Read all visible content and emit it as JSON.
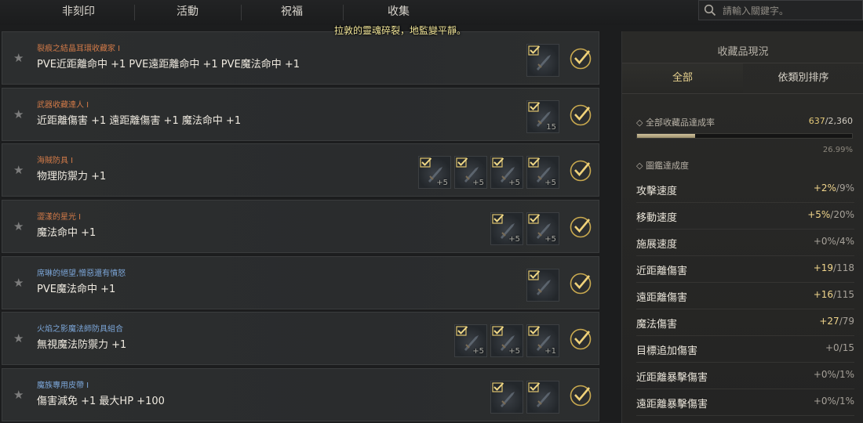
{
  "tabs": [
    {
      "label": "非刻印"
    },
    {
      "label": "活動"
    },
    {
      "label": "祝福"
    },
    {
      "label": "收集"
    }
  ],
  "search": {
    "placeholder": "請輸入關鍵字。"
  },
  "system_message": "拉敦的靈魂碎裂，地監變平靜。",
  "collections": [
    {
      "title": "裂痕之結晶耳環收藏家 I",
      "title_color": "orange",
      "effect": "PVE近距離命中 +1 PVE遠距離命中 +1 PVE魔法命中 +1",
      "items": [
        {
          "count": ""
        }
      ]
    },
    {
      "title": "武器收藏達人 I",
      "title_color": "orange",
      "effect": "近距離傷害 +1 遠距離傷害 +1 魔法命中 +1",
      "items": [
        {
          "count": "15"
        }
      ]
    },
    {
      "title": "海賊防具 I",
      "title_color": "orange",
      "effect": "物理防禦力 +1",
      "items": [
        {
          "count": "+5"
        },
        {
          "count": "+5"
        },
        {
          "count": "+5"
        },
        {
          "count": "+5"
        }
      ]
    },
    {
      "title": "澀漾的星光 I",
      "title_color": "orange",
      "effect": "魔法命中 +1",
      "items": [
        {
          "count": "+5"
        },
        {
          "count": "+5"
        }
      ]
    },
    {
      "title": "席琳的絕望,憎惡還有憤怒",
      "title_color": "blue",
      "effect": "PVE魔法命中 +1",
      "items": [
        {
          "count": ""
        }
      ]
    },
    {
      "title": "火焰之影魔法師防具組合",
      "title_color": "blue",
      "effect": "無視魔法防禦力 +1",
      "items": [
        {
          "count": "+5"
        },
        {
          "count": "+5"
        },
        {
          "count": "+1"
        }
      ]
    },
    {
      "title": "魔族專用皮帶 I",
      "title_color": "blue",
      "effect": "傷害減免 +1 最大HP +100",
      "items": [
        {
          "count": ""
        },
        {
          "count": ""
        }
      ]
    }
  ],
  "panel": {
    "title": "收藏品現況",
    "tab_all": "全部",
    "tab_category": "依類別排序",
    "overall_label": "全部收藏品達成率",
    "overall_done": "637",
    "overall_total": "/2,360",
    "overall_progress": 0.2699,
    "overall_percent": "26.99%",
    "codex_label": "圖鑑達成度",
    "stats": [
      {
        "name": "攻擊速度",
        "current": "+2%",
        "max": "/9%"
      },
      {
        "name": "移動速度",
        "current": "+5%",
        "max": "/20%"
      },
      {
        "name": "施展速度",
        "current": "+0%",
        "max": "/4%"
      },
      {
        "name": "近距離傷害",
        "current": "+19",
        "max": "/118"
      },
      {
        "name": "遠距離傷害",
        "current": "+16",
        "max": "/115"
      },
      {
        "name": "魔法傷害",
        "current": "+27",
        "max": "/79"
      },
      {
        "name": "目標追加傷害",
        "current": "+0",
        "max": "/15"
      },
      {
        "name": "近距離暴擊傷害",
        "current": "+0%",
        "max": "/1%"
      },
      {
        "name": "遠距離暴擊傷害",
        "current": "+0%",
        "max": "/1%"
      }
    ]
  },
  "colors": {
    "gold": "#e5c978",
    "orange_title": "#d27a48",
    "blue_title": "#7ca6d8"
  }
}
